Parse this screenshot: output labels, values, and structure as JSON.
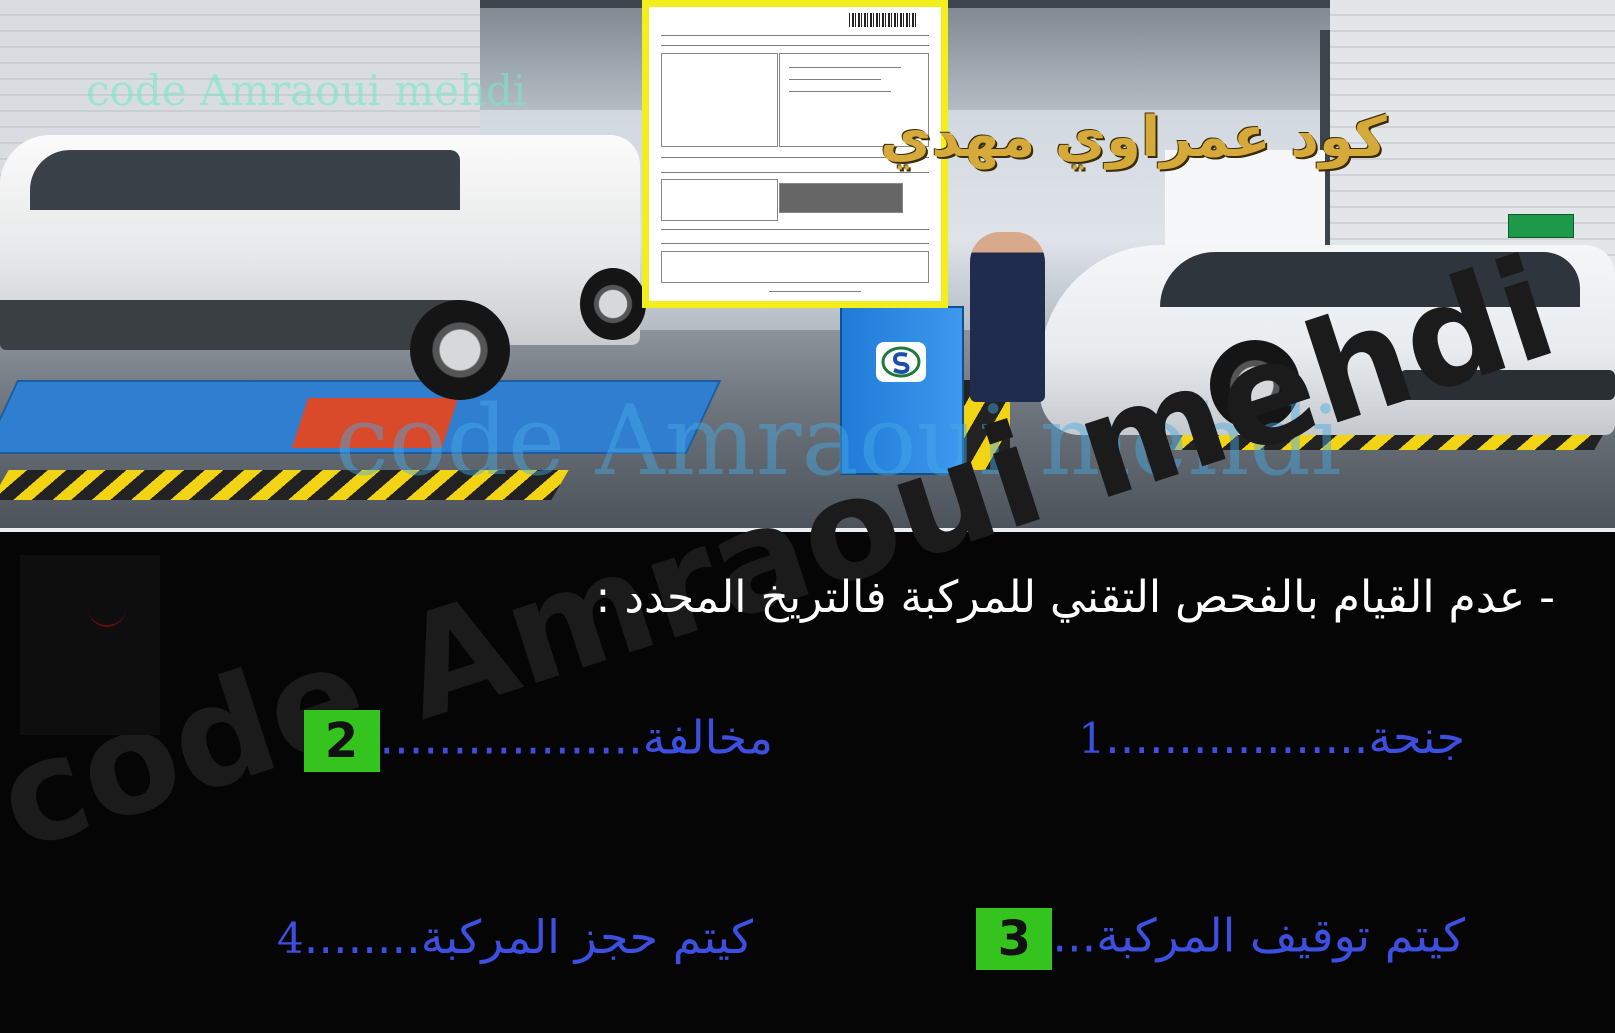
{
  "scene": {
    "watermark_latin_top": "code Amraoui mehdi",
    "watermark_arabic": "كود عمراوي مهدي",
    "watermark_latin_mid": "code Amraoui mehdi"
  },
  "quiz": {
    "background_watermark": "code Amraoui mehdi",
    "question": "- عدم القيام بالفحص التقني للمركبة فالتريخ المحدد :",
    "options": [
      {
        "number": "1",
        "label": "جنحة",
        "dots": "..................",
        "highlighted": false
      },
      {
        "number": "2",
        "label": "مخالفة",
        "dots": "..................",
        "highlighted": true
      },
      {
        "number": "3",
        "label": "كيتم توقيف المركبة",
        "dots": "...",
        "highlighted": true
      },
      {
        "number": "4",
        "label": "كيتم حجز المركبة",
        "dots": "........",
        "highlighted": false
      }
    ]
  },
  "colors": {
    "question_text": "#ffffff",
    "option_text": "#3c4fe0",
    "answer_badge": "#35c41e",
    "document_frame": "#f3ef1c"
  }
}
